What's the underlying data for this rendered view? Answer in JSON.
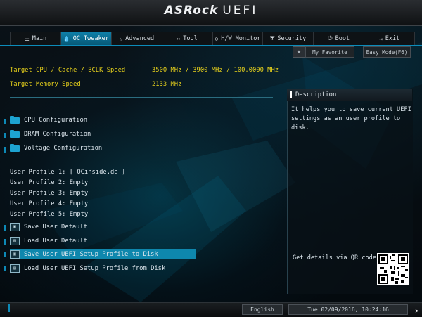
{
  "header": {
    "brand": "ASRock",
    "product": "UEFI"
  },
  "tabs": [
    {
      "label": "Main",
      "icon": "list-icon"
    },
    {
      "label": "OC Tweaker",
      "icon": "flame-icon"
    },
    {
      "label": "Advanced",
      "icon": "star-icon"
    },
    {
      "label": "Tool",
      "icon": "tool-icon"
    },
    {
      "label": "H/W Monitor",
      "icon": "monitor-icon"
    },
    {
      "label": "Security",
      "icon": "shield-icon"
    },
    {
      "label": "Boot",
      "icon": "power-icon"
    },
    {
      "label": "Exit",
      "icon": "exit-icon"
    }
  ],
  "active_tab": "OC Tweaker",
  "toolbar": {
    "favorite_label": "My Favorite",
    "easy_mode_label": "Easy Mode(F6)"
  },
  "info": {
    "target_cpu_label": "Target CPU / Cache / BCLK Speed",
    "target_cpu_value": "3500 MHz / 3900 MHz / 100.0000 MHz",
    "target_mem_label": "Target Memory Speed",
    "target_mem_value": "2133 MHz"
  },
  "submenus": [
    "CPU Configuration",
    "DRAM Configuration",
    "Voltage Configuration"
  ],
  "profiles": [
    "User Profile 1: [ OCinside.de ]",
    "User Profile 2: Empty",
    "User Profile 3: Empty",
    "User Profile 4: Empty",
    "User Profile 5: Empty"
  ],
  "actions": [
    "Save User Default",
    "Load User Default",
    "Save User UEFI Setup Profile to Disk",
    "Load User UEFI Setup Profile from Disk"
  ],
  "selected_action": "Save User UEFI Setup Profile to Disk",
  "description": {
    "title": "Description",
    "text": "It helps you to save current UEFI settings as an user profile to disk.",
    "qr_label": "Get details via QR code"
  },
  "footer": {
    "language": "English",
    "datetime": "Tue 02/09/2016, 10:24:16"
  },
  "colors": {
    "accent": "#0e87ad",
    "highlight_text": "#e8d21c",
    "tab_active": "#0f7fa8"
  }
}
